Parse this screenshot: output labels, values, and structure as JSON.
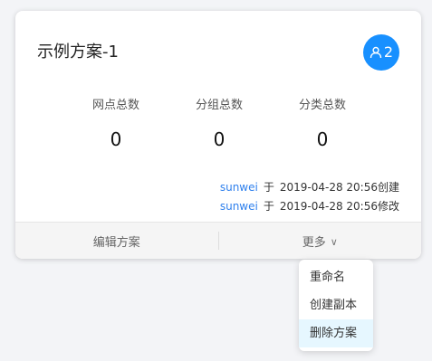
{
  "card": {
    "title": "示例方案-1",
    "member_count": "2",
    "stats": [
      {
        "label": "网点总数",
        "value": "0"
      },
      {
        "label": "分组总数",
        "value": "0"
      },
      {
        "label": "分类总数",
        "value": "0"
      }
    ],
    "logs": [
      {
        "user": "sunwei",
        "sep": "于",
        "text": "2019-04-28 20:56创建"
      },
      {
        "user": "sunwei",
        "sep": "于",
        "text": "2019-04-28 20:56修改"
      }
    ],
    "footer": {
      "edit_label": "编辑方案",
      "more_label": "更多",
      "more_chevron": "∨"
    }
  },
  "dropdown": {
    "items": [
      "重命名",
      "创建副本",
      "删除方案"
    ]
  },
  "colors": {
    "accent": "#1890ff",
    "link": "#2f80ed",
    "active_item_bg": "#e6f7ff"
  }
}
